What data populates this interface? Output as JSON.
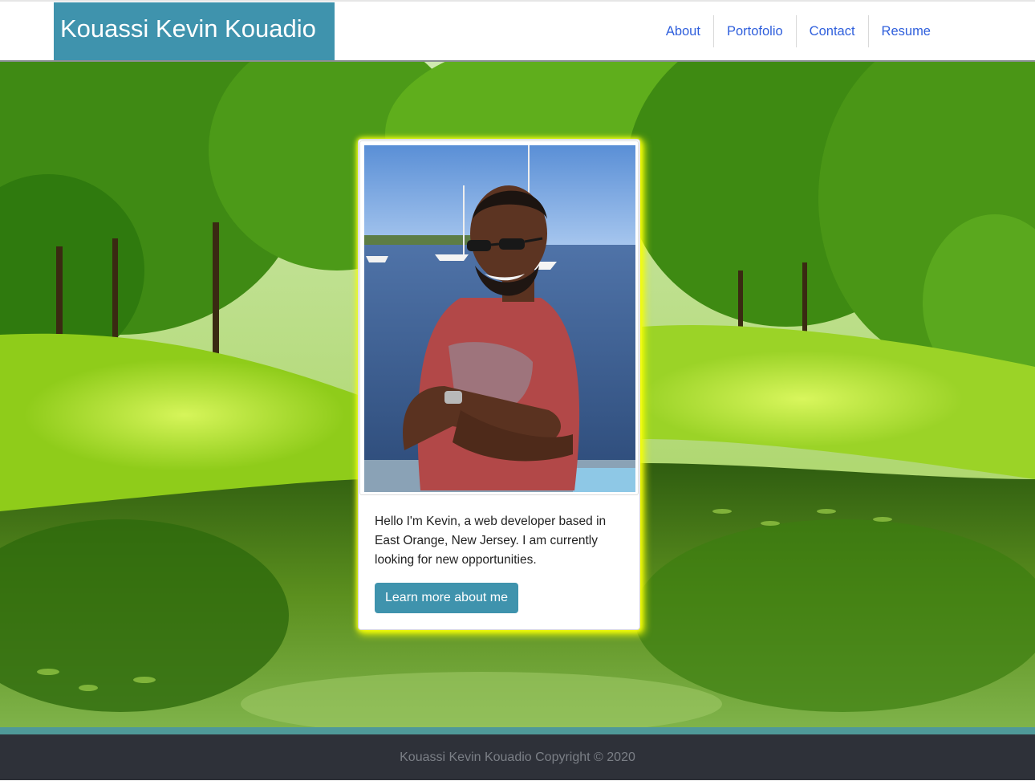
{
  "header": {
    "brand": "Kouassi Kevin Kouadio",
    "nav": [
      {
        "label": "About"
      },
      {
        "label": "Portofolio"
      },
      {
        "label": "Contact"
      },
      {
        "label": "Resume"
      }
    ]
  },
  "card": {
    "text": "Hello I'm Kevin, a web developer based in East Orange, New Jersey. I am currently looking for new opportunities.",
    "button_label": "Learn more about me"
  },
  "footer": {
    "text": "Kouassi Kevin Kouadio Copyright © 2020"
  },
  "colors": {
    "brand_bg": "#3f93ad",
    "nav_link": "#2f5fdc",
    "button_bg": "#3f93ad",
    "card_glow": "#f7ff00",
    "footer_bg": "#2e3139",
    "footer_strip": "#4f9999"
  }
}
